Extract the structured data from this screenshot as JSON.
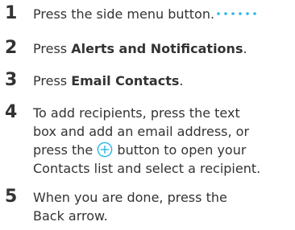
{
  "steps": [
    {
      "number": "1",
      "pre": "Press the side menu button.",
      "icon": "side-menu-dots-icon"
    },
    {
      "number": "2",
      "pre": "Press ",
      "bold": "Alerts and Notifications",
      "post": "."
    },
    {
      "number": "3",
      "pre": "Press ",
      "bold": "Email Contacts",
      "post": "."
    },
    {
      "number": "4",
      "line1": "To add recipients, press the text",
      "line2": "box and add an email address, or",
      "line3_pre": "press the ",
      "line3_post": " button to open your",
      "line4": "Contacts list and select a recipient.",
      "icon": "add-circle-icon"
    },
    {
      "number": "5",
      "line1": "When you are done, press the",
      "line2": "Back arrow."
    }
  ],
  "colors": {
    "text": "#333333",
    "accent": "#29b6e8"
  }
}
